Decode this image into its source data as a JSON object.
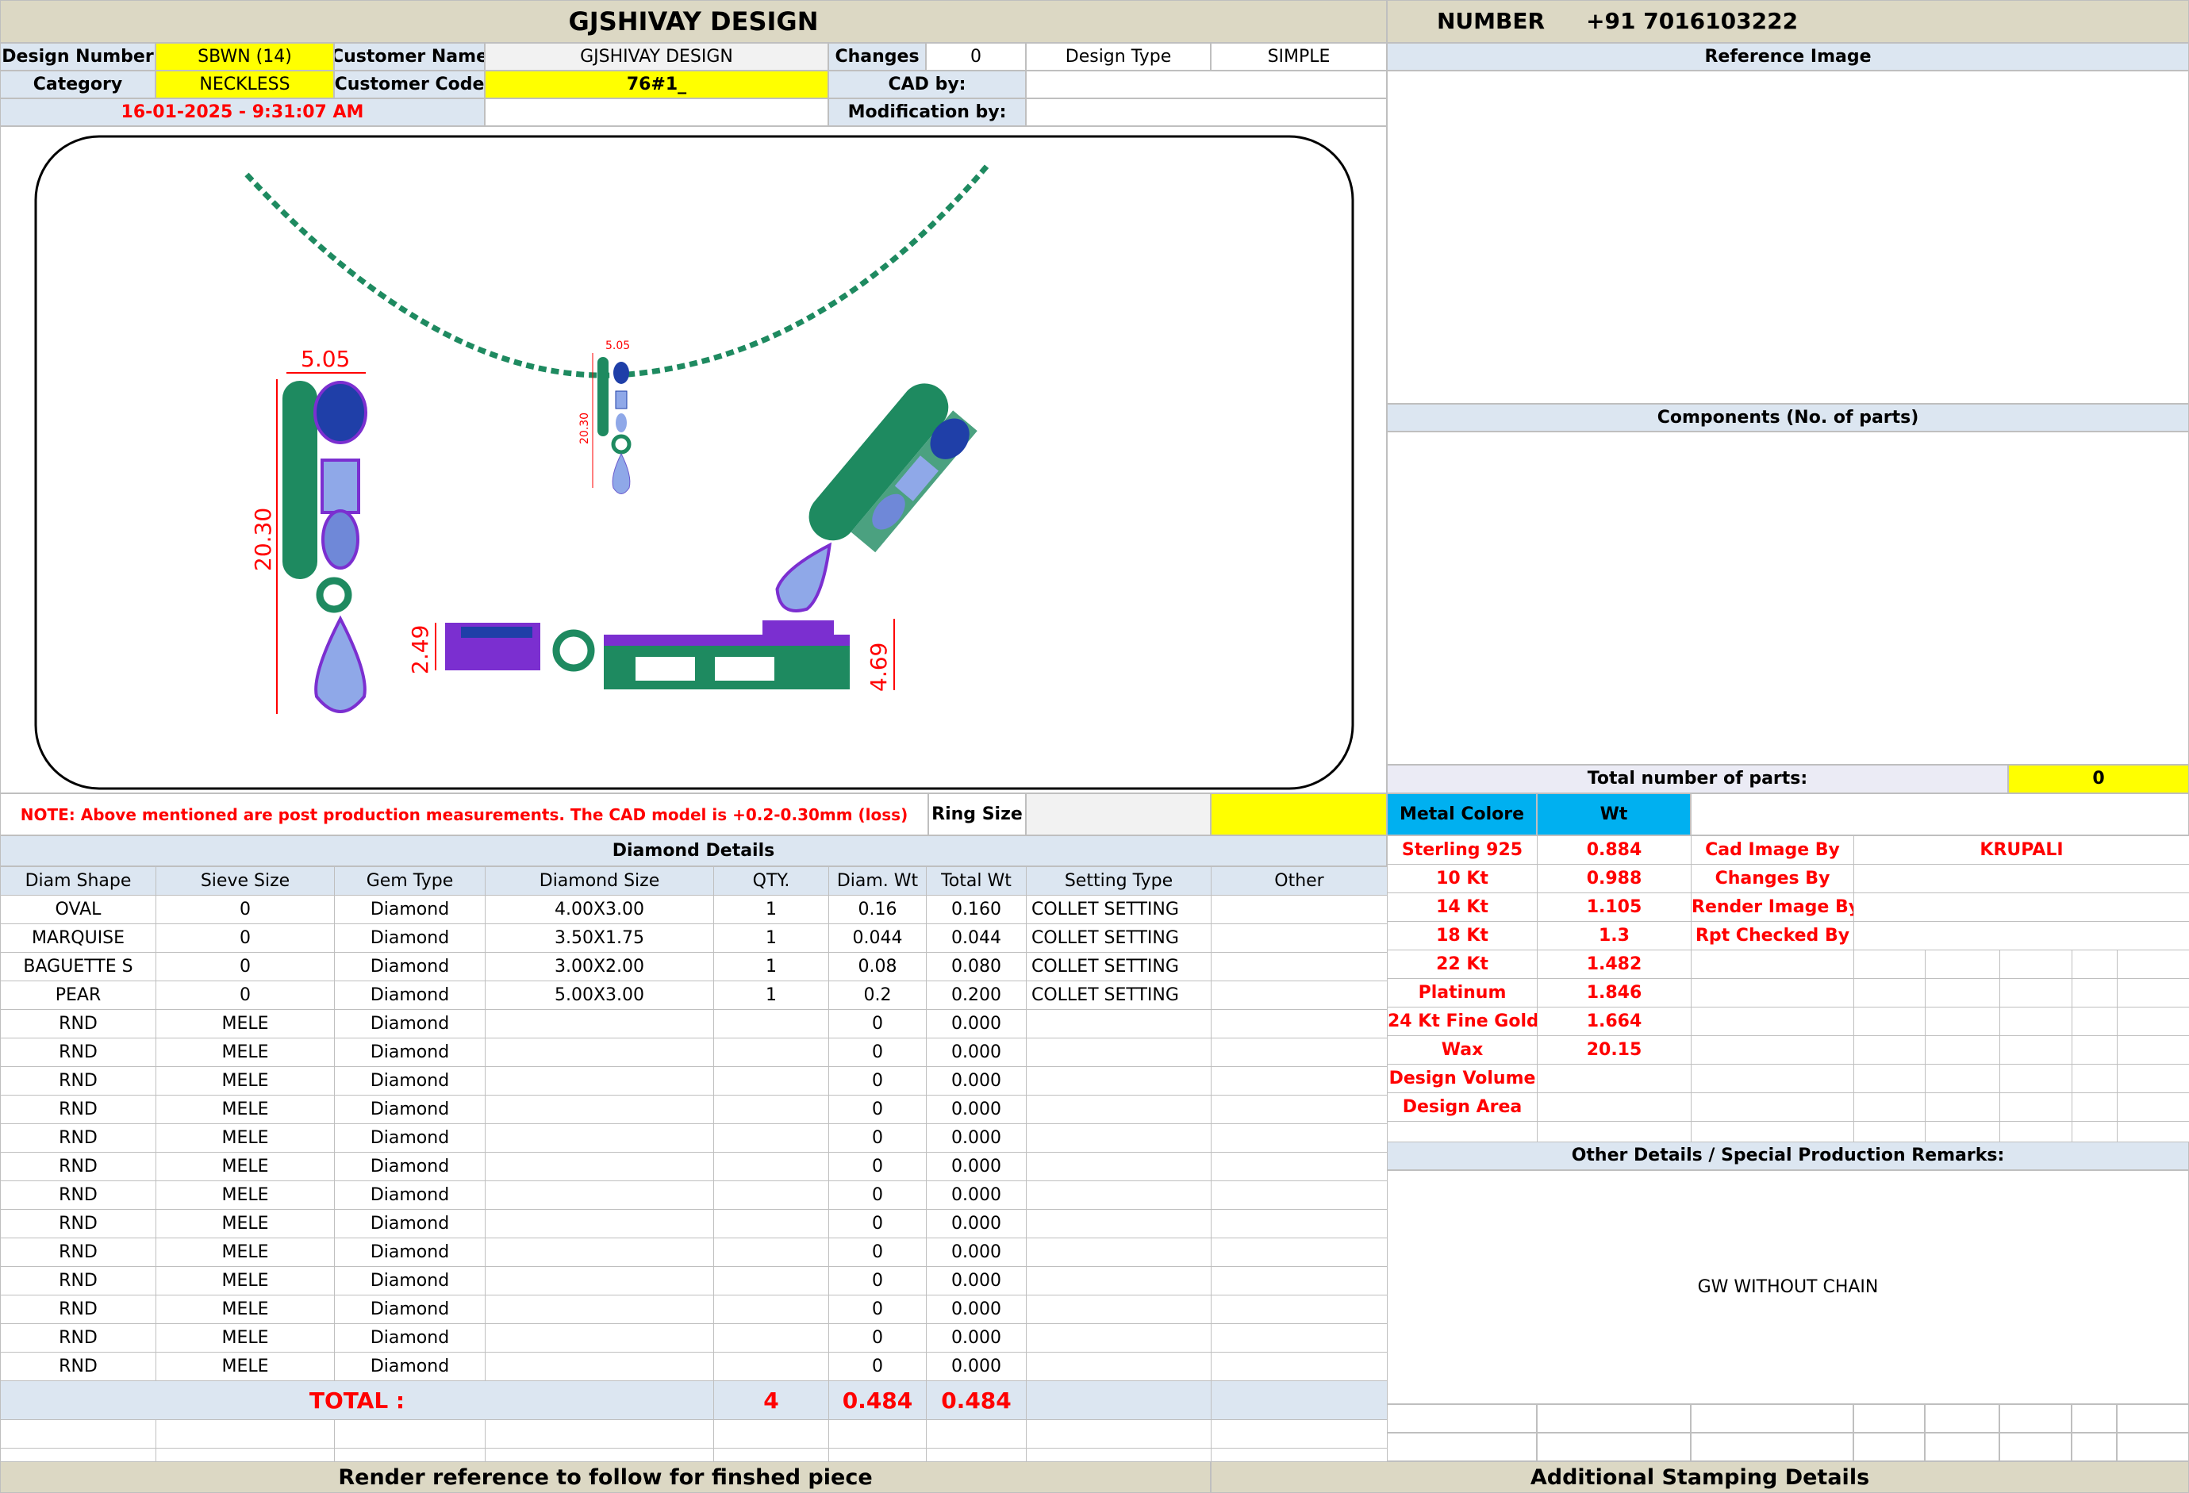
{
  "header": {
    "title": "GJSHIVAY DESIGN",
    "number_label": "NUMBER",
    "number_value": "+91 7016103222"
  },
  "info": {
    "design_number_label": "Design Number",
    "design_number_value": "SBWN (14)",
    "customer_name_label": "Customer Name",
    "customer_name_value": "GJSHIVAY DESIGN",
    "changes_label": "Changes",
    "changes_value": "0",
    "design_type_label": "Design Type",
    "design_type_value": "SIMPLE",
    "category_label": "Category",
    "category_value": "NECKLESS",
    "customer_code_label": "Customer Code",
    "customer_code_value": "76#1_",
    "cad_by_label": "CAD by:",
    "modification_by_label": "Modification by:",
    "datetime": "16-01-2025 - 9:31:07 AM"
  },
  "reference_image_label": "Reference Image",
  "components_label": "Components (No. of parts)",
  "total_parts_label": "Total number of parts:",
  "total_parts_value": "0",
  "drawing": {
    "dim_width": "5.05",
    "dim_height": "20.30",
    "dim_small_width": "5.05",
    "dim_small_height": "20.30",
    "dim_side_left": "2.49",
    "dim_side_right": "4.69"
  },
  "note": "NOTE: Above mentioned are post production measurements. The CAD model is +0.2-0.30mm (loss)",
  "ring_size_label": "Ring Size",
  "diamond_details_label": "Diamond Details",
  "diamond_columns": [
    "Diam Shape",
    "Sieve Size",
    "Gem Type",
    "Diamond Size",
    "QTY.",
    "Diam. Wt",
    "Total Wt",
    "Setting Type",
    "Other"
  ],
  "diamond_rows": [
    [
      "OVAL",
      "0",
      "Diamond",
      "4.00X3.00",
      "1",
      "0.16",
      "0.160",
      "COLLET SETTING",
      ""
    ],
    [
      "MARQUISE",
      "0",
      "Diamond",
      "3.50X1.75",
      "1",
      "0.044",
      "0.044",
      "COLLET SETTING",
      ""
    ],
    [
      "BAGUETTE S",
      "0",
      "Diamond",
      "3.00X2.00",
      "1",
      "0.08",
      "0.080",
      "COLLET SETTING",
      ""
    ],
    [
      "PEAR",
      "0",
      "Diamond",
      "5.00X3.00",
      "1",
      "0.2",
      "0.200",
      "COLLET SETTING",
      ""
    ],
    [
      "RND",
      "MELE",
      "Diamond",
      "",
      "",
      "0",
      "0.000",
      "",
      ""
    ],
    [
      "RND",
      "MELE",
      "Diamond",
      "",
      "",
      "0",
      "0.000",
      "",
      ""
    ],
    [
      "RND",
      "MELE",
      "Diamond",
      "",
      "",
      "0",
      "0.000",
      "",
      ""
    ],
    [
      "RND",
      "MELE",
      "Diamond",
      "",
      "",
      "0",
      "0.000",
      "",
      ""
    ],
    [
      "RND",
      "MELE",
      "Diamond",
      "",
      "",
      "0",
      "0.000",
      "",
      ""
    ],
    [
      "RND",
      "MELE",
      "Diamond",
      "",
      "",
      "0",
      "0.000",
      "",
      ""
    ],
    [
      "RND",
      "MELE",
      "Diamond",
      "",
      "",
      "0",
      "0.000",
      "",
      ""
    ],
    [
      "RND",
      "MELE",
      "Diamond",
      "",
      "",
      "0",
      "0.000",
      "",
      ""
    ],
    [
      "RND",
      "MELE",
      "Diamond",
      "",
      "",
      "0",
      "0.000",
      "",
      ""
    ],
    [
      "RND",
      "MELE",
      "Diamond",
      "",
      "",
      "0",
      "0.000",
      "",
      ""
    ],
    [
      "RND",
      "MELE",
      "Diamond",
      "",
      "",
      "0",
      "0.000",
      "",
      ""
    ],
    [
      "RND",
      "MELE",
      "Diamond",
      "",
      "",
      "0",
      "0.000",
      "",
      ""
    ],
    [
      "RND",
      "MELE",
      "Diamond",
      "",
      "",
      "0",
      "0.000",
      "",
      ""
    ]
  ],
  "totals": {
    "label": "TOTAL :",
    "qty": "4",
    "diam_wt": "0.484",
    "total_wt": "0.484"
  },
  "metal": {
    "header_colore": "Metal Colore",
    "header_wt": "Wt",
    "rows": [
      [
        "Sterling 925",
        "0.884"
      ],
      [
        "10 Kt",
        "0.988"
      ],
      [
        "14 Kt",
        "1.105"
      ],
      [
        "18 Kt",
        "1.3"
      ],
      [
        "22 Kt",
        "1.482"
      ],
      [
        "Platinum",
        "1.846"
      ],
      [
        "24 Kt Fine Gold",
        "1.664"
      ],
      [
        "Wax",
        "20.15"
      ],
      [
        "Design Volume",
        ""
      ],
      [
        "Design Area",
        ""
      ]
    ],
    "credits": [
      [
        "Cad Image By",
        "KRUPALI"
      ],
      [
        "Changes By",
        ""
      ],
      [
        "Render Image By",
        ""
      ],
      [
        "Rpt Checked By",
        ""
      ]
    ]
  },
  "other_details_label": "Other Details / Special Production Remarks:",
  "remarks": "GW WITHOUT CHAIN",
  "footer": {
    "render_ref": "Render reference to follow for finshed piece",
    "stamping": "Additional Stamping Details"
  },
  "colors": {
    "header_bg": "#dcd8c4",
    "section_bg": "#dce6f1",
    "highlight": "#ffff00",
    "metal_header": "#00b0f0",
    "metal_green": "#1e8a60",
    "prong_purple": "#8a2be2",
    "gem_blue": "#1f3fa8",
    "gem_light": "#8fa8e8",
    "dimension_red": "#ff0000"
  }
}
